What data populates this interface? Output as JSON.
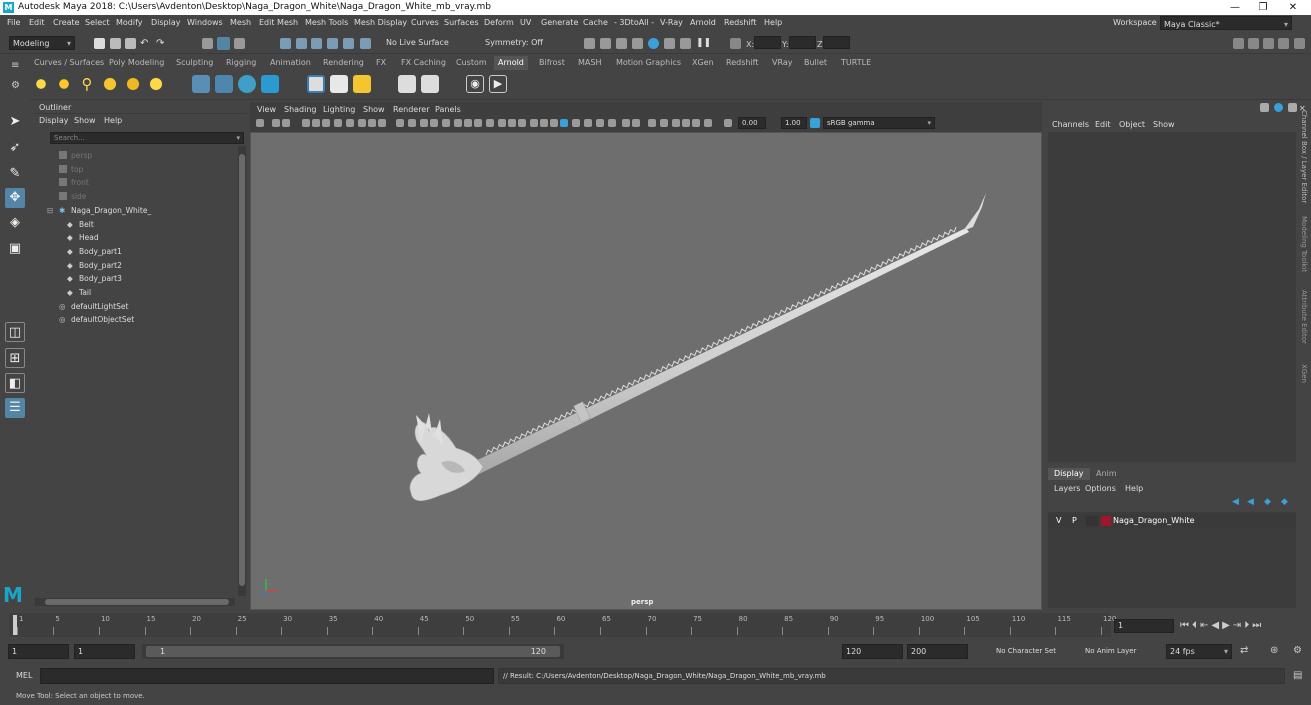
{
  "window": {
    "title": "Autodesk Maya 2018: C:\\Users\\Avdenton\\Desktop\\Naga_Dragon_White\\Naga_Dragon_White_mb_vray.mb",
    "minimize": "—",
    "maximize": "❐",
    "close": "✕"
  },
  "menubar": [
    "File",
    "Edit",
    "Create",
    "Select",
    "Modify",
    "Display",
    "Windows",
    "Mesh",
    "Edit Mesh",
    "Mesh Tools",
    "Mesh Display",
    "Curves",
    "Surfaces",
    "Deform",
    "UV",
    "Generate",
    "Cache",
    "- 3DtoAll -",
    "V-Ray",
    "Arnold",
    "Redshift",
    "Help"
  ],
  "workspace": {
    "label": "Workspace :",
    "value": "Maya Classic*"
  },
  "statusline": {
    "mode": "Modeling",
    "live_surface": "No Live Surface",
    "symmetry": "Symmetry: Off",
    "x_label": "X:",
    "y_label": "Y:",
    "z_label": "Z:"
  },
  "shelf_tabs": [
    "Curves / Surfaces",
    "Poly Modeling",
    "Sculpting",
    "Rigging",
    "Animation",
    "Rendering",
    "FX",
    "FX Caching",
    "Custom",
    "Arnold",
    "Bifrost",
    "MASH",
    "Motion Graphics",
    "XGen",
    "Redshift",
    "VRay",
    "Bullet",
    "TURTLE"
  ],
  "shelf_active": "Arnold",
  "outliner": {
    "title": "Outliner",
    "menu": [
      "Display",
      "Show",
      "Help"
    ],
    "search_placeholder": "Search...",
    "items": [
      {
        "label": "persp",
        "dim": true,
        "indent": 1
      },
      {
        "label": "top",
        "dim": true,
        "indent": 1
      },
      {
        "label": "front",
        "dim": true,
        "indent": 1
      },
      {
        "label": "side",
        "dim": true,
        "indent": 1
      },
      {
        "label": "Naga_Dragon_White_",
        "dim": false,
        "indent": 1,
        "expand": "⊟"
      },
      {
        "label": "Belt",
        "dim": false,
        "indent": 2
      },
      {
        "label": "Head",
        "dim": false,
        "indent": 2
      },
      {
        "label": "Body_part1",
        "dim": false,
        "indent": 2
      },
      {
        "label": "Body_part2",
        "dim": false,
        "indent": 2
      },
      {
        "label": "Body_part3",
        "dim": false,
        "indent": 2
      },
      {
        "label": "Tail",
        "dim": false,
        "indent": 2
      },
      {
        "label": "defaultLightSet",
        "dim": false,
        "indent": 1
      },
      {
        "label": "defaultObjectSet",
        "dim": false,
        "indent": 1
      }
    ]
  },
  "viewport": {
    "menu": [
      "View",
      "Shading",
      "Lighting",
      "Show",
      "Renderer",
      "Panels"
    ],
    "exposure": "0.00",
    "gamma": "1.00",
    "color_space": "sRGB gamma",
    "camera_label": "persp"
  },
  "channelbox": {
    "menu": [
      "Channels",
      "Edit",
      "Object",
      "Show"
    ],
    "layer_tabs": [
      "Display",
      "Anim"
    ],
    "layer_menu": [
      "Layers",
      "Options",
      "Help"
    ],
    "layer": {
      "v": "V",
      "p": "P",
      "name": "Naga_Dragon_White",
      "color": "#a0152a"
    }
  },
  "side_tabs": [
    "Channel Box / Layer Editor",
    "Modeling Toolkit",
    "Attribute Editor",
    "XGen"
  ],
  "timeline": {
    "ticks": [
      "1",
      "5",
      "10",
      "15",
      "20",
      "25",
      "30",
      "35",
      "40",
      "45",
      "50",
      "55",
      "60",
      "65",
      "70",
      "75",
      "80",
      "85",
      "90",
      "95",
      "100",
      "105",
      "110",
      "115",
      "120"
    ],
    "current_frame": "1"
  },
  "range": {
    "start": "1",
    "playback_start": "1",
    "slider_start": "1",
    "slider_end": "120",
    "playback_end": "120",
    "end": "200",
    "character_set": "No Character Set",
    "anim_layer": "No Anim Layer",
    "fps": "24 fps"
  },
  "cmdline": {
    "lang": "MEL",
    "result": "// Result: C:/Users/Avdenton/Desktop/Naga_Dragon_White/Naga_Dragon_White_mb_vray.mb"
  },
  "helpline": "Move Tool: Select an object to move.",
  "colors": {
    "accent": "#5285a6",
    "layer_red": "#a0152a",
    "maya_blue": "#1aa6c8"
  }
}
